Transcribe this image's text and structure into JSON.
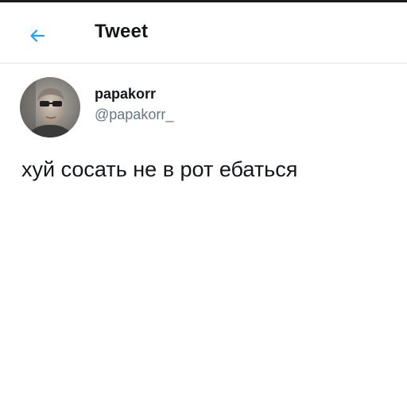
{
  "header": {
    "title": "Tweet",
    "back_icon": "arrow-left-icon",
    "accent_color": "#1da1f2"
  },
  "tweet": {
    "author": {
      "display_name": "papakorr",
      "handle": "@papakorr_"
    },
    "text": "хуй сосать не в рот ебаться"
  }
}
